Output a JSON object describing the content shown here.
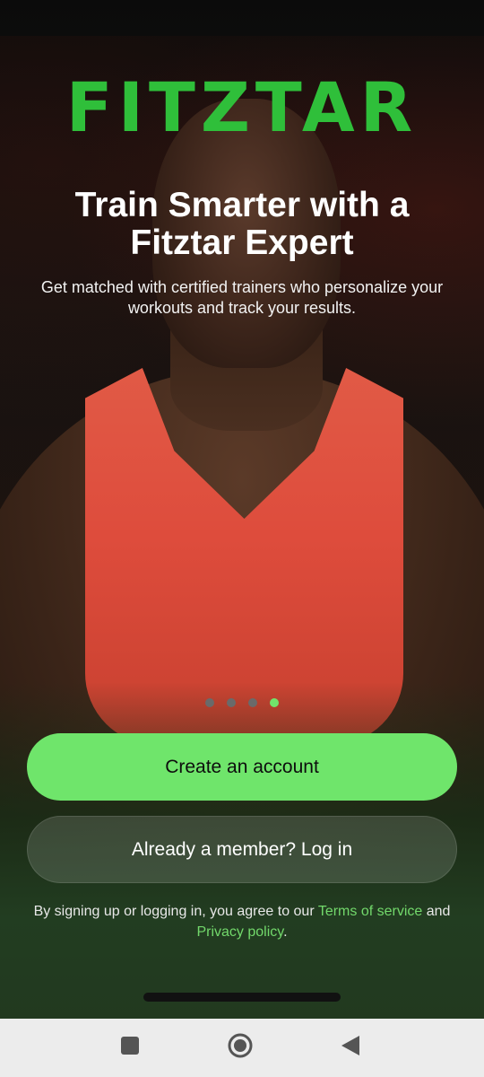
{
  "brand": {
    "logo_text": "FITZTAR",
    "accent": "#2fbf3a"
  },
  "hero": {
    "title": "Train Smarter with a Fitztar Expert",
    "subtitle": "Get matched with certified trainers who personalize your workouts and track your results."
  },
  "carousel": {
    "total_pages": 4,
    "active_page": 4
  },
  "actions": {
    "create_account_label": "Create an account",
    "login_label": "Already a member? Log in"
  },
  "legal": {
    "prefix": "By signing up or logging in, you agree to our",
    "terms_link": "Terms of service",
    "and": "and",
    "privacy_link": "Privacy policy",
    "suffix": "."
  },
  "colors": {
    "primary_button": "#6fe56b",
    "link": "#72d86b",
    "active_dot": "#71e36b",
    "inactive_dot": "#6a6a6a",
    "navbar": "#ececec"
  },
  "system_nav": {
    "icons": [
      "square-recents-icon",
      "circle-home-icon",
      "triangle-back-icon"
    ]
  }
}
